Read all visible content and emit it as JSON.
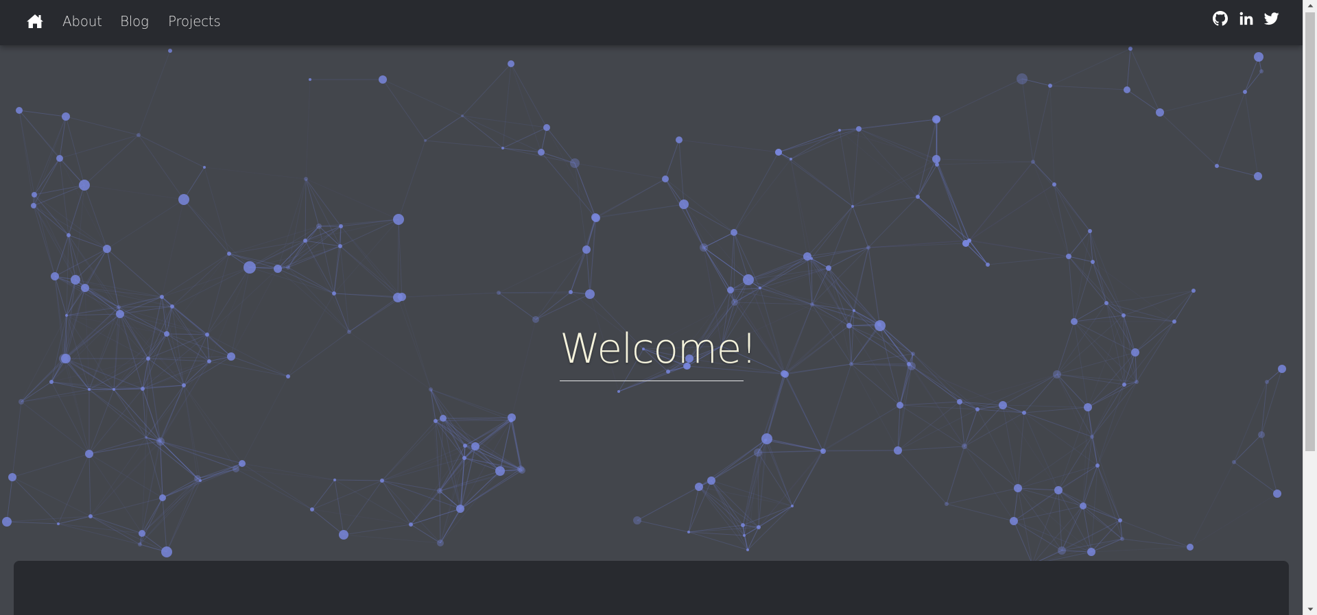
{
  "nav": {
    "home_icon": "home-icon",
    "links": [
      "About",
      "Blog",
      "Projects"
    ]
  },
  "social": {
    "icons": [
      "github-icon",
      "linkedin-icon",
      "twitter-icon"
    ]
  },
  "hero": {
    "title": "Welcome!"
  },
  "colors": {
    "background": "#43464c",
    "navbar": "#282a2f",
    "node": "#6f7fd6",
    "title": "#f5f3dc"
  }
}
